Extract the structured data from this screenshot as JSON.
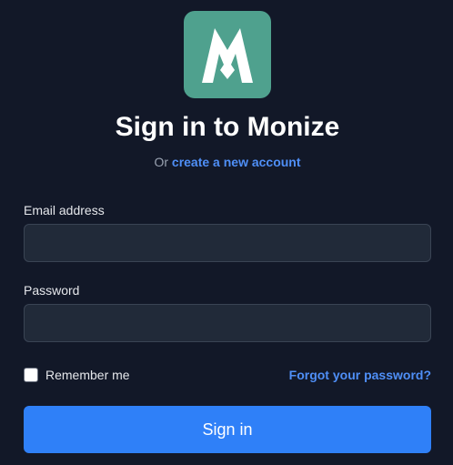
{
  "brand": {
    "logo_icon": "monize-m-logo-icon",
    "logo_color": "#4fa18e"
  },
  "header": {
    "title": "Sign in to Monize",
    "subtitle_prefix": "Or",
    "create_account_link": "create a new account"
  },
  "form": {
    "email_label": "Email address",
    "email_value": "",
    "password_label": "Password",
    "password_value": "",
    "remember_label": "Remember me",
    "remember_checked": false,
    "forgot_link": "Forgot your password?",
    "submit_label": "Sign in"
  },
  "colors": {
    "background": "#121828",
    "accent": "#2f80f8",
    "link": "#4f8ff7",
    "input_bg": "#212a39"
  }
}
